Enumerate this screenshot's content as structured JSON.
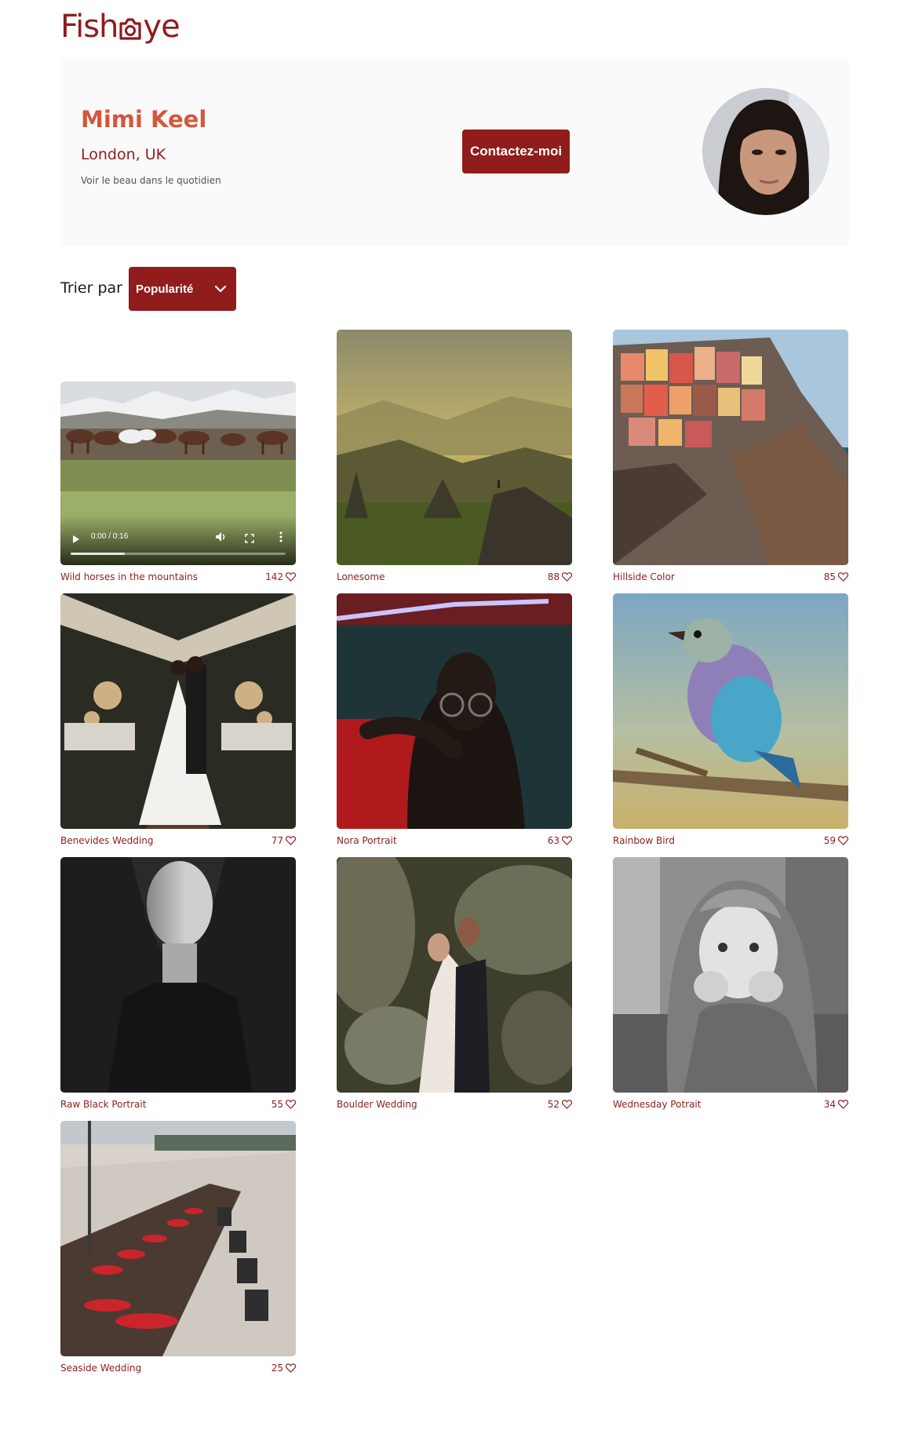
{
  "logo": {
    "text_before": "Fish",
    "text_after": "ye"
  },
  "photographer": {
    "name": "Mimi Keel",
    "location": "London, UK",
    "tagline": "Voir le beau dans le quotidien",
    "contact_label": "Contactez-moi"
  },
  "sort": {
    "label": "Trier par",
    "selected": "Popularité"
  },
  "video_player": {
    "time": "0:00 / 0:16",
    "progress": 0.25
  },
  "media": [
    {
      "title": "Wild horses in the mountains",
      "likes": "142",
      "kind": "video"
    },
    {
      "title": "Lonesome",
      "likes": "88",
      "kind": "image"
    },
    {
      "title": "Hillside Color",
      "likes": "85",
      "kind": "image"
    },
    {
      "title": "Benevides Wedding",
      "likes": "77",
      "kind": "image"
    },
    {
      "title": "Nora Portrait",
      "likes": "63",
      "kind": "image"
    },
    {
      "title": "Rainbow Bird",
      "likes": "59",
      "kind": "image"
    },
    {
      "title": "Raw Black Portrait",
      "likes": "55",
      "kind": "image"
    },
    {
      "title": "Boulder Wedding",
      "likes": "52",
      "kind": "image"
    },
    {
      "title": "Wednesday Potrait",
      "likes": "34",
      "kind": "image"
    },
    {
      "title": "Seaside Wedding",
      "likes": "25",
      "kind": "image"
    }
  ],
  "colors": {
    "brand": "#901c1c",
    "name_accent": "#d3573c",
    "header_bg": "#fafafa"
  },
  "icons": {
    "like": "heart-outline-icon",
    "sort": "chevron-down-icon",
    "logo": "camera-icon"
  }
}
